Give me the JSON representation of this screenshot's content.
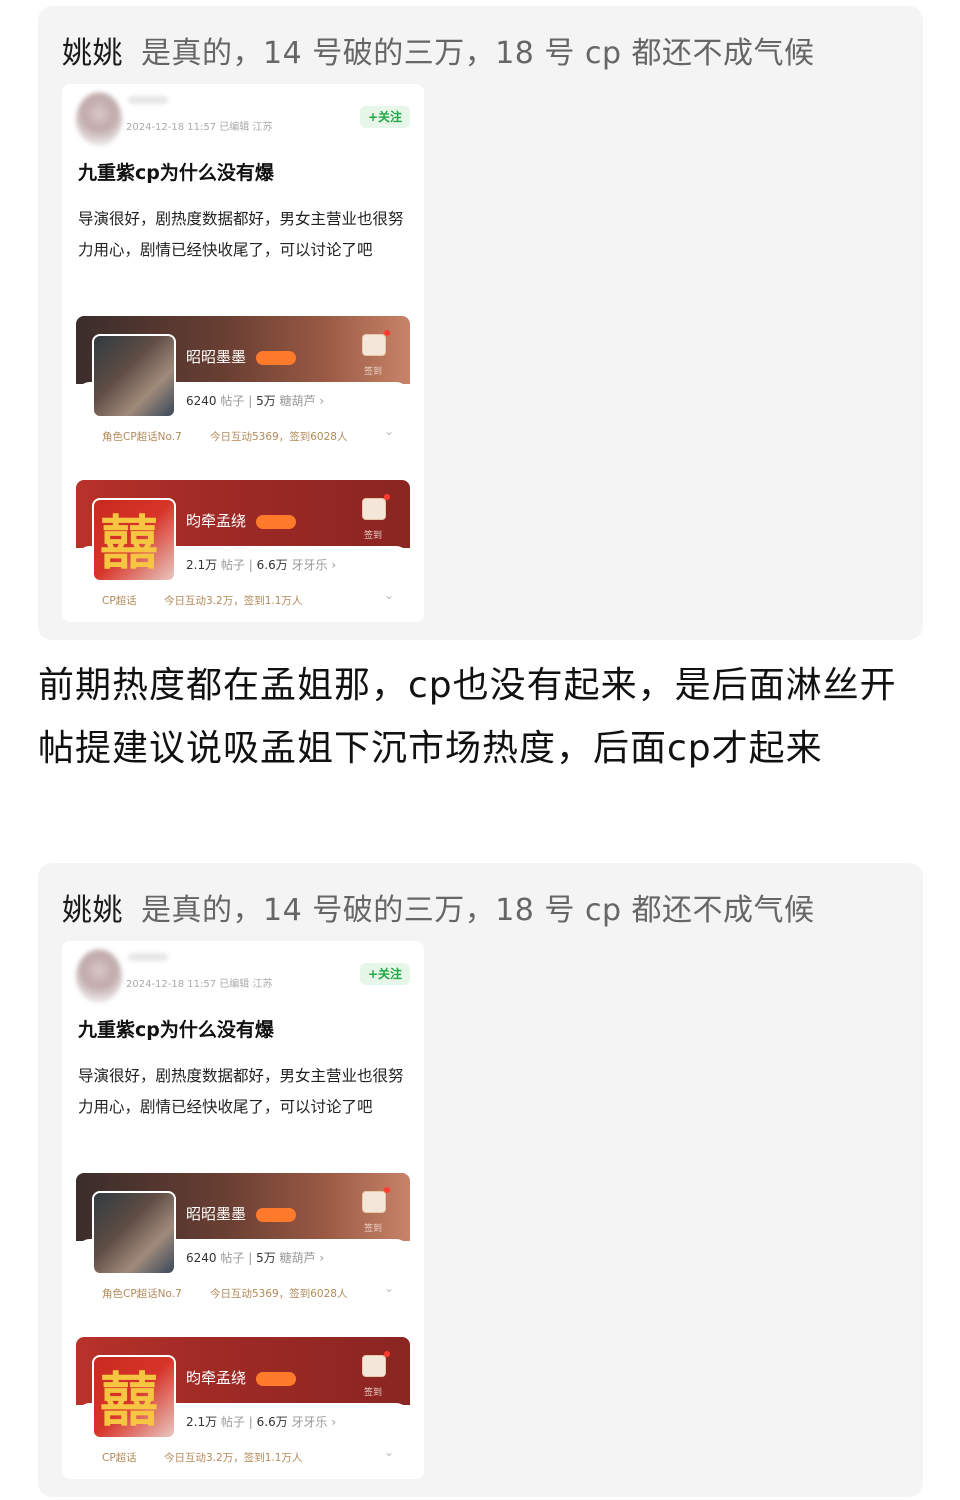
{
  "quote": {
    "user": "姚姚",
    "text": "是真的，14 号破的三万，18 号 cp 都还不成气候"
  },
  "post": {
    "meta": "2024-12-18 11:57  已编辑  江苏",
    "follow_label": "+关注",
    "title": "九重紫cp为什么没有爆",
    "body": "导演很好，剧热度数据都好，男女主营业也很努力用心，剧情已经快收尾了，可以讨论了吧"
  },
  "chaohua": [
    {
      "name": "昭昭墨墨",
      "posts": "6240",
      "posts_label": "帖子",
      "fans": "5万",
      "fans_label": "糖葫芦 ›",
      "tag": "角色CP超话No.7",
      "activity": "今日互动5369，签到6028人",
      "checkin": "签到"
    },
    {
      "name": "昀牵孟绕",
      "posts": "2.1万",
      "posts_label": "帖子",
      "fans": "6.6万",
      "fans_label": "牙牙乐 ›",
      "tag": "CP超话",
      "activity": "今日互动3.2万，签到1.1万人",
      "checkin": "签到",
      "cover_glyph": "囍"
    }
  ],
  "main_text": "前期热度都在孟姐那，cp也没有起来，是后面淋丝开帖提建议说吸孟姐下沉市场热度，后面cp才起来"
}
